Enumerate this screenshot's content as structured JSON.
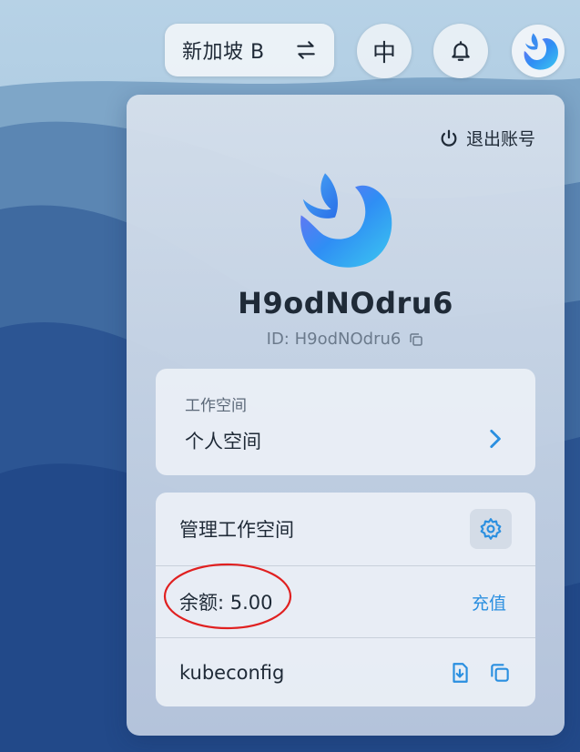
{
  "topbar": {
    "region_label": "新加坡 B",
    "language_label": "中"
  },
  "panel": {
    "logout_label": "退出账号",
    "username": "H9odNOdru6",
    "user_id_text": "ID: H9odNOdru6",
    "workspace": {
      "title": "工作空间",
      "current": "个人空间"
    },
    "management": {
      "manage_label": "管理工作空间",
      "balance_label": "余额: 5.00",
      "recharge_label": "充值",
      "kubeconfig_label": "kubeconfig"
    }
  },
  "colors": {
    "accent": "#2a8fe0",
    "annotation_red": "#e02020",
    "text_primary": "#1f2a37",
    "text_secondary": "#6b7a8c"
  },
  "icons": [
    "swap-icon",
    "bell-icon",
    "power-icon",
    "copy-icon",
    "chevron-right-icon",
    "gear-icon",
    "download-file-icon"
  ]
}
